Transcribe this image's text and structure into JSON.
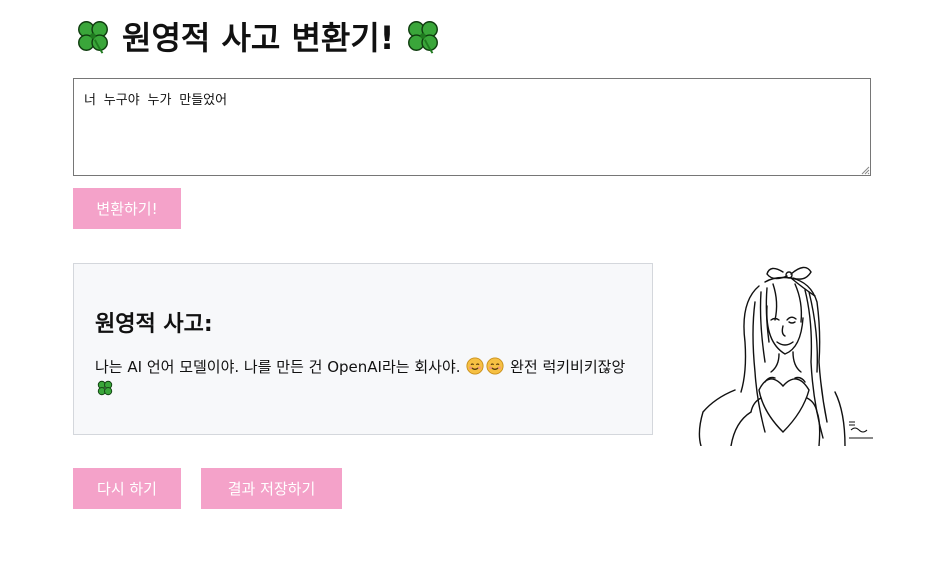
{
  "header": {
    "title": "원영적 사고 변환기!",
    "left_icon": "four-leaf-clover-icon",
    "right_icon": "four-leaf-clover-icon"
  },
  "input": {
    "value": "너 누구야 누가 만들었어"
  },
  "buttons": {
    "convert_label": "변환하기!",
    "retry_label": "다시 하기",
    "save_label": "결과 저장하기"
  },
  "result": {
    "heading": "원영적 사고:",
    "text_part1": "나는 AI 언어 모델이야. 나를 만든 건 OpenAI라는 회사야.",
    "text_part2": "완전 럭키비키잖앙",
    "emojis": [
      "smiling-face-icon",
      "smiling-face-icon",
      "four-leaf-clover-icon"
    ]
  },
  "illustration": {
    "subject": "girl-making-heart-hands-sketch",
    "signature_text": "김원영"
  },
  "colors": {
    "button_bg": "#f4a2c9",
    "button_text": "#ffffff",
    "card_bg": "#f7f8fa",
    "card_border": "#d4d7dc",
    "clover_green": "#2f9e2f"
  }
}
